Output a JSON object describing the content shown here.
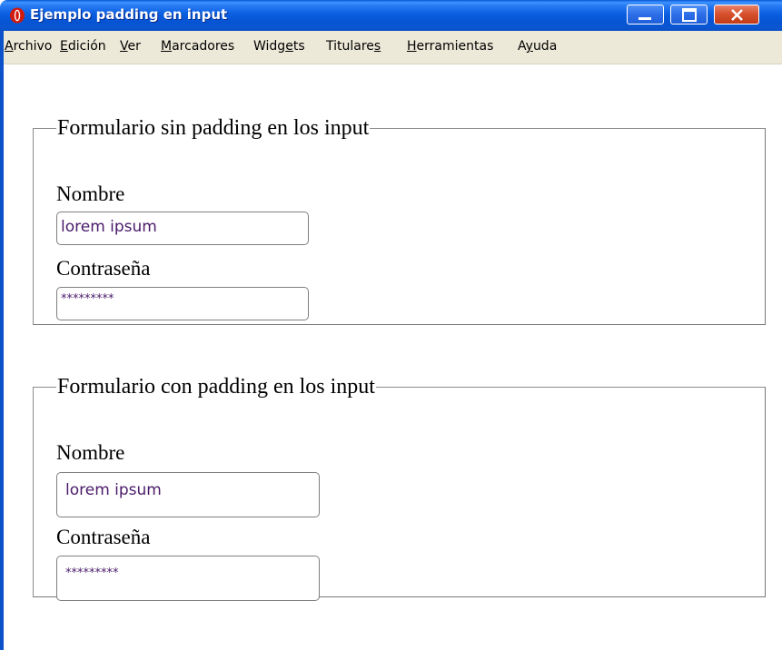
{
  "window": {
    "title": "Ejemplo padding en input",
    "app_icon": "opera-icon",
    "colors": {
      "titlebar": "#0a5fe0",
      "close_button": "#d7512f",
      "menubar": "#ece9d8",
      "input_text": "#4a1a6a"
    }
  },
  "menu": {
    "items": [
      {
        "label": "Archivo",
        "accel_index": 0
      },
      {
        "label": "Edición",
        "accel_index": 0
      },
      {
        "label": "Ver",
        "accel_index": 0
      },
      {
        "label": "Marcadores",
        "accel_index": 0
      },
      {
        "label": "Widgets",
        "accel_index": 4
      },
      {
        "label": "Titulares",
        "accel_index": 8
      },
      {
        "label": "Herramientas",
        "accel_index": 0
      },
      {
        "label": "Ayuda",
        "accel_index": 1
      }
    ]
  },
  "form1": {
    "legend": "Formulario sin padding en los input",
    "name_label": "Nombre",
    "name_value": "lorem ipsum",
    "password_label": "Contraseña",
    "password_value": "*********"
  },
  "form2": {
    "legend": "Formulario con padding en los input",
    "name_label": "Nombre",
    "name_value": "lorem ipsum",
    "password_label": "Contraseña",
    "password_value": "*********"
  }
}
